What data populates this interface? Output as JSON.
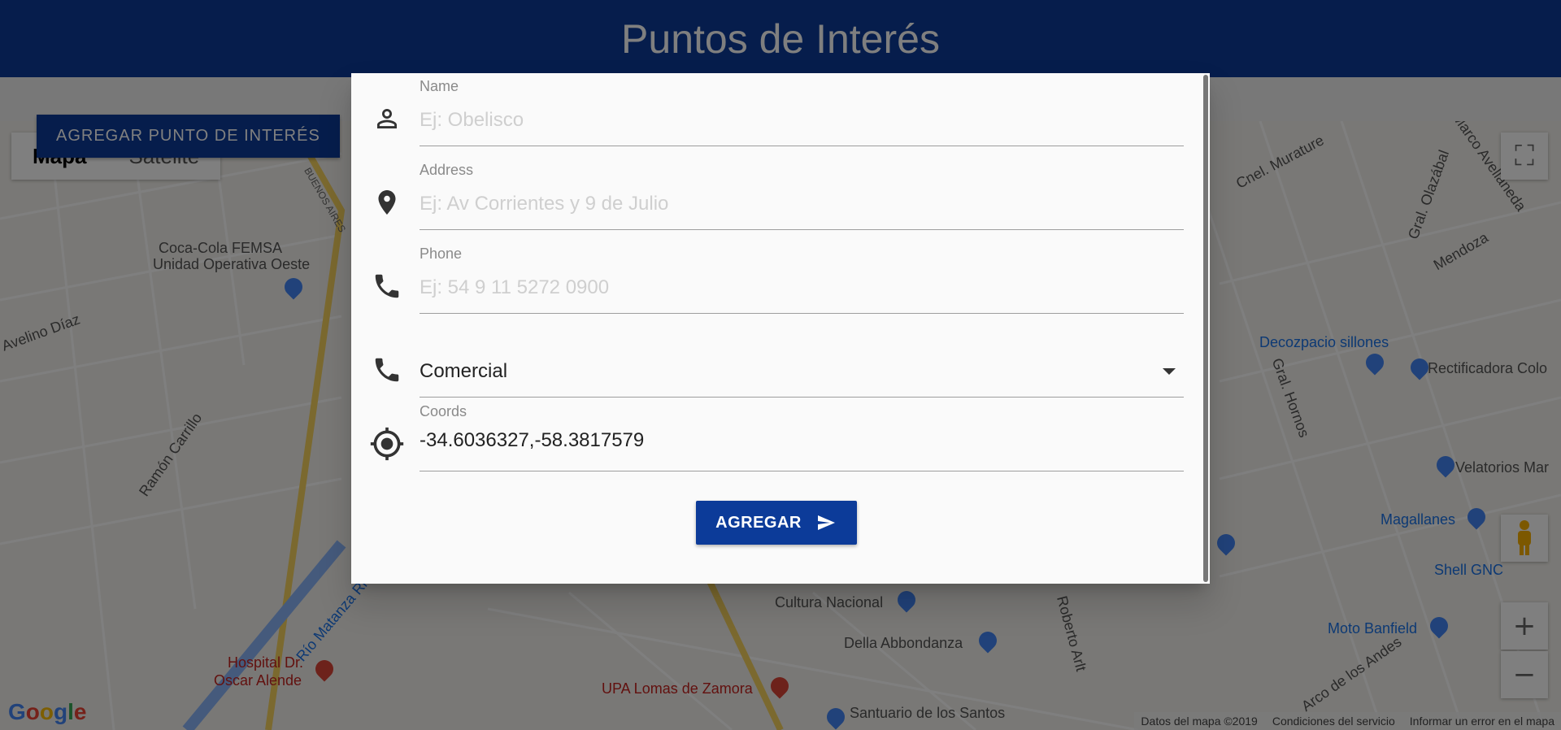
{
  "header": {
    "title": "Puntos de Interés"
  },
  "toolbar": {
    "add_poi_label": "AGREGAR PUNTO DE INTERÉS"
  },
  "map": {
    "type_options": [
      "Mapa",
      "Satélite"
    ],
    "selected_type": "Mapa",
    "labels": {
      "coca_cola_1": "Coca-Cola FEMSA",
      "coca_cola_2": "Unidad Operativa Oeste",
      "avelino": "Avelino Díaz",
      "ramon": "Ramón Carrillo",
      "rio": "Río Matanza Riachuelo",
      "hospital_1": "Hospital Dr.",
      "hospital_2": "Oscar Alende",
      "upa": "UPA Lomas de Zamora",
      "cultura": "Cultura Nacional",
      "della": "Della Abbondanza",
      "santuario": "Santuario de los Santos",
      "roberto": "Roberto Arlt",
      "decozpacio": "Decozpacio sillones",
      "rectificadora": "Rectificadora Colo",
      "velatorios": "Velatorios Mar",
      "magallanes": "Magallanes",
      "shell": "Shell GNC",
      "moto": "Moto Banfield",
      "murature": "Cnel. Murature",
      "olazabal": "Gral. Olazábal",
      "mendoza": "Mendoza",
      "hornos": "Gral. Hornos",
      "marco": "Marco Avellaneda",
      "andes": "Arco de los Andes",
      "buenos": "BUENOS AIRES"
    },
    "footer": {
      "data": "Datos del mapa ©2019",
      "terms": "Condiciones del servicio",
      "report": "Informar un error en el mapa"
    },
    "logo": "Google"
  },
  "dialog": {
    "name": {
      "label": "Name",
      "placeholder": "Ej: Obelisco",
      "icon": "person-icon"
    },
    "address": {
      "label": "Address",
      "placeholder": "Ej: Av Corrientes y 9 de Julio",
      "icon": "location-pin-icon"
    },
    "phone": {
      "label": "Phone",
      "placeholder": "Ej: 54 9 11 5272 0900",
      "icon": "phone-icon"
    },
    "category": {
      "value": "Comercial",
      "icon": "phone-icon"
    },
    "coords": {
      "label": "Coords",
      "value": "-34.6036327,-58.3817579",
      "icon": "gps-fixed-icon"
    },
    "submit_label": "AGREGAR"
  },
  "colors": {
    "primary": "#0c3b99",
    "dialog_bg": "#fafafa"
  }
}
